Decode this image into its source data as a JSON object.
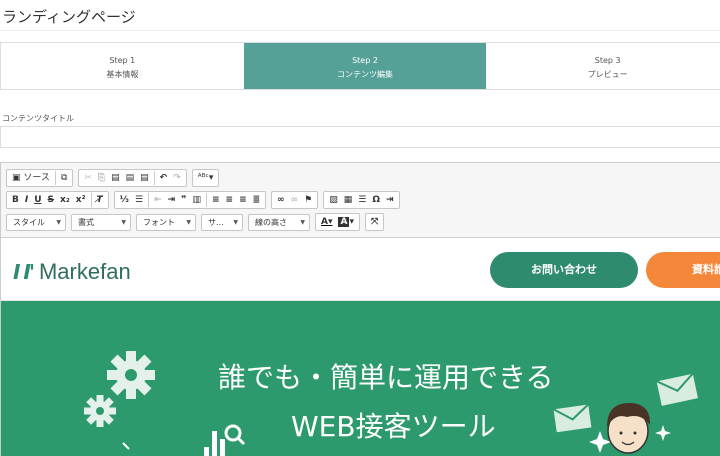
{
  "page": {
    "title": "ランディングページ"
  },
  "steps": [
    {
      "step": "Step 1",
      "label": "基本情報"
    },
    {
      "step": "Step 2",
      "label": "コンテンツ編集"
    },
    {
      "step": "Step 3",
      "label": "プレビュー"
    }
  ],
  "content_title": {
    "label": "コンテンツタイトル",
    "value": ""
  },
  "toolbar": {
    "source_label": "ソース",
    "style_combo": "スタイル",
    "format_combo": "書式",
    "font_combo": "フォント",
    "size_combo": "サ...",
    "lineheight_combo": "線の高さ"
  },
  "site": {
    "logo_mark": "I I'",
    "logo_text": "Markefan",
    "contact_button": "お問い合わせ",
    "doc_button": "資料請求"
  },
  "hero": {
    "line1": "誰でも・簡単に運用できる",
    "line2": "WEB接客ツール"
  },
  "colors": {
    "accent": "#55a197",
    "brand_green": "#2f8b70",
    "hero_green": "#2d9a6e",
    "orange": "#f5873a"
  }
}
